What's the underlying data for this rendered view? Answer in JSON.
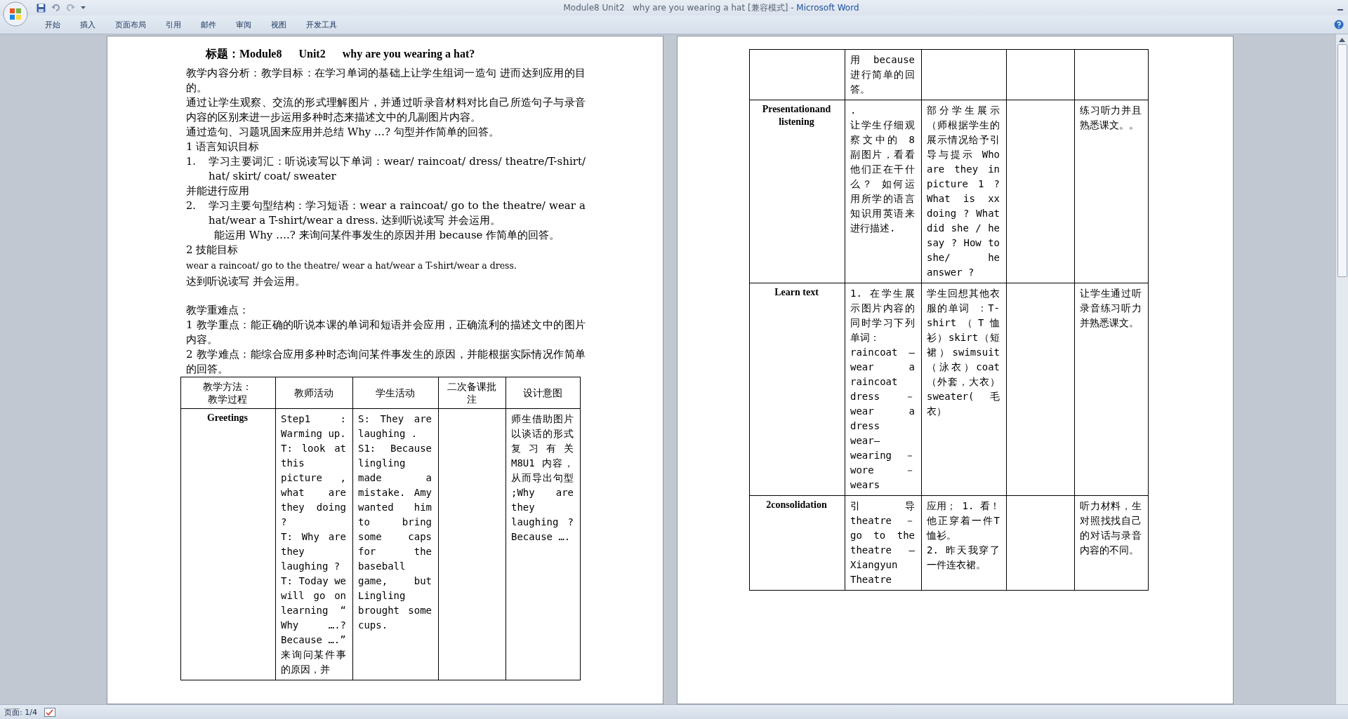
{
  "window": {
    "title": "Module8 Unit2   why are you wearing a hat [兼容模式] - ",
    "app_name": "Microsoft Word"
  },
  "ribbon_tabs": [
    {
      "label": "开始",
      "selected": false
    },
    {
      "label": "插入",
      "selected": false
    },
    {
      "label": "页面布局",
      "selected": false
    },
    {
      "label": "引用",
      "selected": false
    },
    {
      "label": "邮件",
      "selected": false
    },
    {
      "label": "审阅",
      "selected": false
    },
    {
      "label": "视图",
      "selected": false
    },
    {
      "label": "开发工具",
      "selected": false
    }
  ],
  "pages": [
    {
      "heading": "标题：Module8      Unit2      why are you wearing a hat?",
      "paragraphs": [
        {
          "kind": "para",
          "text": "教学内容分析：教学目标：在学习单词的基础上让学生组词一造句 进而达到应用的目的。"
        },
        {
          "kind": "para",
          "text": "通过让学生观察、交流的形式理解图片，并通过听录音材料对比自己所造句子与录音内容的区别来进一步运用多种时态来描述文中的几副图片内容。"
        },
        {
          "kind": "para",
          "text": "通过造句、习题巩固来应用并总结 Why …? 句型并作简单的回答。"
        },
        {
          "kind": "para",
          "text": "1 语言知识目标"
        },
        {
          "kind": "list",
          "marker": "1.",
          "text": "学习主要词汇：听说读写以下单词：wear/ raincoat/ dress/ theatre/T-shirt/ hat/ skirt/ coat/ sweater"
        },
        {
          "kind": "para",
          "text": " 并能进行应用"
        },
        {
          "kind": "list",
          "marker": "2.",
          "text": "学习主要句型结构：学习短语：wear a raincoat/ go to the theatre/ wear a hat/wear a T-shirt/wear a dress. 达到听说读写 并会运用。"
        },
        {
          "kind": "indent",
          "text": "能运用 Why ….? 来询问某件事发生的原因并用 because 作简单的回答。"
        },
        {
          "kind": "para",
          "text": "2 技能目标"
        },
        {
          "kind": "small",
          "text": "wear a raincoat/ go to the theatre/ wear a hat/wear a T-shirt/wear a dress."
        },
        {
          "kind": "para",
          "text": "达到听说读写 并会运用。"
        },
        {
          "kind": "gap"
        },
        {
          "kind": "para",
          "text": "教学重难点："
        },
        {
          "kind": "para",
          "text": "1 教学重点：能正确的听说本课的单词和短语并会应用，正确流利的描述文中的图片内容。"
        },
        {
          "kind": "para",
          "text": "2 教学难点：能综合应用多种时态询问某件事发生的原因，并能根据实际情况作简单的回答。"
        }
      ],
      "table": {
        "header": [
          [
            "教学方法：",
            "教学过程"
          ],
          [
            "教师活动"
          ],
          [
            "学生活动"
          ],
          [
            "二次备课批注"
          ],
          [
            "设计意图"
          ]
        ],
        "rows": [
          {
            "stage": "Greetings",
            "cells": [
              [
                "Step1 : Warming up.",
                "T: look at this picture , what are they doing ?",
                "T: Why are they laughing ?",
                "T: Today we will go on learning “ Why ….? Because ….”",
                "来询问某件事的原因，并"
              ],
              [
                "S: They are laughing .",
                "S1: Because lingling made a mistake. Amy wanted him to bring some caps for the baseball game, but Lingling brought some cups."
              ],
              [],
              [
                "师生借助图片以谈话的形式复习有关 M8U1 内容，从而导出句型 ;Why are they laughing ? Because …."
              ]
            ]
          }
        ]
      }
    },
    {
      "table": {
        "rows": [
          {
            "stage": "",
            "cells": [
              [
                "用 because 进行简单的回答。"
              ],
              [],
              [],
              []
            ]
          },
          {
            "stage": "Presentationand listening",
            "cells": [
              [
                ".",
                "让学生仔细观察文中的 8 副图片，看看他们正在干什么？ 如何运用所学的语言知识用英语来进行描述."
              ],
              [
                "部分学生展示（师根据学生的展示情况给予引导与提示 Who are they in picture 1 ? What is xx doing ? What did she / he say ? How to she/ he answer ?"
              ],
              [],
              [
                "练习听力并且熟悉课文。。"
              ]
            ]
          },
          {
            "stage": "Learn text",
            "cells": [
              [
                "1.  在学生展示图片内容的同时学习下列单词：",
                "raincoat —wear a raincoat",
                "dress －wear a dress",
                "wear—wearing －wore －wears"
              ],
              [
                "学生回想其他衣服的单词 ：T-shirt（T恤衫）skirt（短裙）swimsuit（泳衣）coat （外套，大衣）sweater(毛衣）"
              ],
              [],
              [
                "让学生通过听录音练习听力并熟悉课文。"
              ]
            ]
          },
          {
            "stage": "2consolidation",
            "cells": [
              [
                "引导 theatre －go to the theatre —Xiangyun Theatre"
              ],
              [
                "应用； 1. 看！他正穿着一件T恤衫。",
                "2. 昨天我穿了一件连衣裙。"
              ],
              [],
              [
                "听力材料，生对照找找自己的对话与录音内容的不同。"
              ]
            ]
          }
        ]
      }
    }
  ],
  "status_bar": {
    "page": "页面: 1/4"
  }
}
